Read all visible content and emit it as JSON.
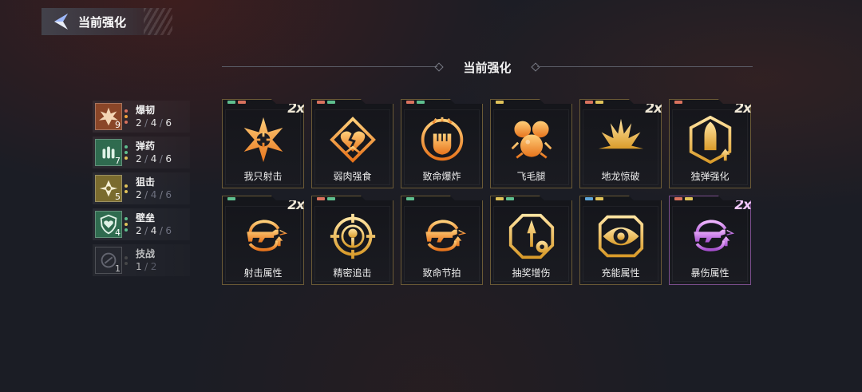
{
  "header": {
    "title": "当前强化"
  },
  "section": {
    "title": "当前强化"
  },
  "colors": {
    "accent_orange": "#f0a13a",
    "accent_gold": "#e8b34c",
    "accent_purple": "#c37ad8",
    "tag_green": "#5fbf8f",
    "tag_red": "#d9725e",
    "tag_yellow": "#e0c35a",
    "tag_blue": "#5fa6d9"
  },
  "sidebar": {
    "items": [
      {
        "name": "爆韧",
        "count": "9",
        "levels": [
          "2",
          "4",
          "6"
        ],
        "active_levels": 3,
        "icon": "explosion-icon",
        "icon_bg": "#8a4628",
        "dots": [
          "#d9725e",
          "#f0a13a",
          "#d9725e"
        ]
      },
      {
        "name": "弹药",
        "count": "7",
        "levels": [
          "2",
          "4",
          "6"
        ],
        "active_levels": 3,
        "icon": "ammo-icon",
        "icon_bg": "#2f6b4f",
        "dots": [
          "#5fbf8f",
          "#5fbf8f",
          "#e0c35a"
        ]
      },
      {
        "name": "狙击",
        "count": "5",
        "levels": [
          "2",
          "4",
          "6"
        ],
        "active_levels": 1,
        "icon": "sniper-icon",
        "icon_bg": "#7a6b2e",
        "dots": [
          "#e0c35a",
          "#e0c35a"
        ]
      },
      {
        "name": "壁垒",
        "count": "4",
        "levels": [
          "2",
          "4",
          "6"
        ],
        "active_levels": 2,
        "icon": "shield-heart-icon",
        "icon_bg": "#2f6b4f",
        "dots": [
          "#5fbf8f",
          "#e0c35a",
          "#5fbf8f"
        ]
      },
      {
        "name": "技战",
        "count": "1",
        "levels": [
          "1",
          "2"
        ],
        "active_levels": 1,
        "icon": "tactic-icon",
        "icon_bg": "#2a2c34",
        "dots": [
          "#555",
          "#555"
        ]
      }
    ]
  },
  "cards": [
    {
      "name": "我只射击",
      "badge": "2x",
      "tags": [
        "#5fbf8f",
        "#d9725e"
      ],
      "icon": "crosshair-star-icon",
      "tone": "orange"
    },
    {
      "name": "弱肉强食",
      "badge": "",
      "tags": [
        "#d9725e",
        "#5fbf8f"
      ],
      "icon": "broken-heart-icon",
      "tone": "orange"
    },
    {
      "name": "致命爆炸",
      "badge": "",
      "tags": [
        "#d9725e",
        "#5fbf8f"
      ],
      "icon": "fist-explosion-icon",
      "tone": "orange"
    },
    {
      "name": "飞毛腿",
      "badge": "",
      "tags": [
        "#e0c35a"
      ],
      "icon": "bomb-cluster-icon",
      "tone": "orange"
    },
    {
      "name": "地龙惊破",
      "badge": "2x",
      "tags": [
        "#d9725e",
        "#e0c35a"
      ],
      "icon": "ground-burst-icon",
      "tone": "gold"
    },
    {
      "name": "独弹强化",
      "badge": "2x",
      "tags": [
        "#d9725e"
      ],
      "icon": "bullet-upgrade-icon",
      "tone": "gold"
    },
    {
      "name": "射击属性",
      "badge": "2x",
      "tags": [
        "#5fbf8f"
      ],
      "icon": "gun-upgrade-icon",
      "tone": "orange"
    },
    {
      "name": "精密追击",
      "badge": "",
      "tags": [
        "#d9725e",
        "#5fbf8f"
      ],
      "icon": "precision-target-icon",
      "tone": "gold"
    },
    {
      "name": "致命节拍",
      "badge": "",
      "tags": [
        "#5fbf8f"
      ],
      "icon": "gun-rhythm-icon",
      "tone": "orange"
    },
    {
      "name": "抽奖增伤",
      "badge": "",
      "tags": [
        "#e0c35a",
        "#5fbf8f"
      ],
      "icon": "lottery-arrow-icon",
      "tone": "gold"
    },
    {
      "name": "充能属性",
      "badge": "",
      "tags": [
        "#5fa6d9",
        "#e0c35a"
      ],
      "icon": "eye-charge-icon",
      "tone": "gold"
    },
    {
      "name": "暴伤属性",
      "badge": "2x",
      "tags": [
        "#d9725e",
        "#e0c35a"
      ],
      "icon": "gun-crit-icon",
      "tone": "purple"
    }
  ]
}
